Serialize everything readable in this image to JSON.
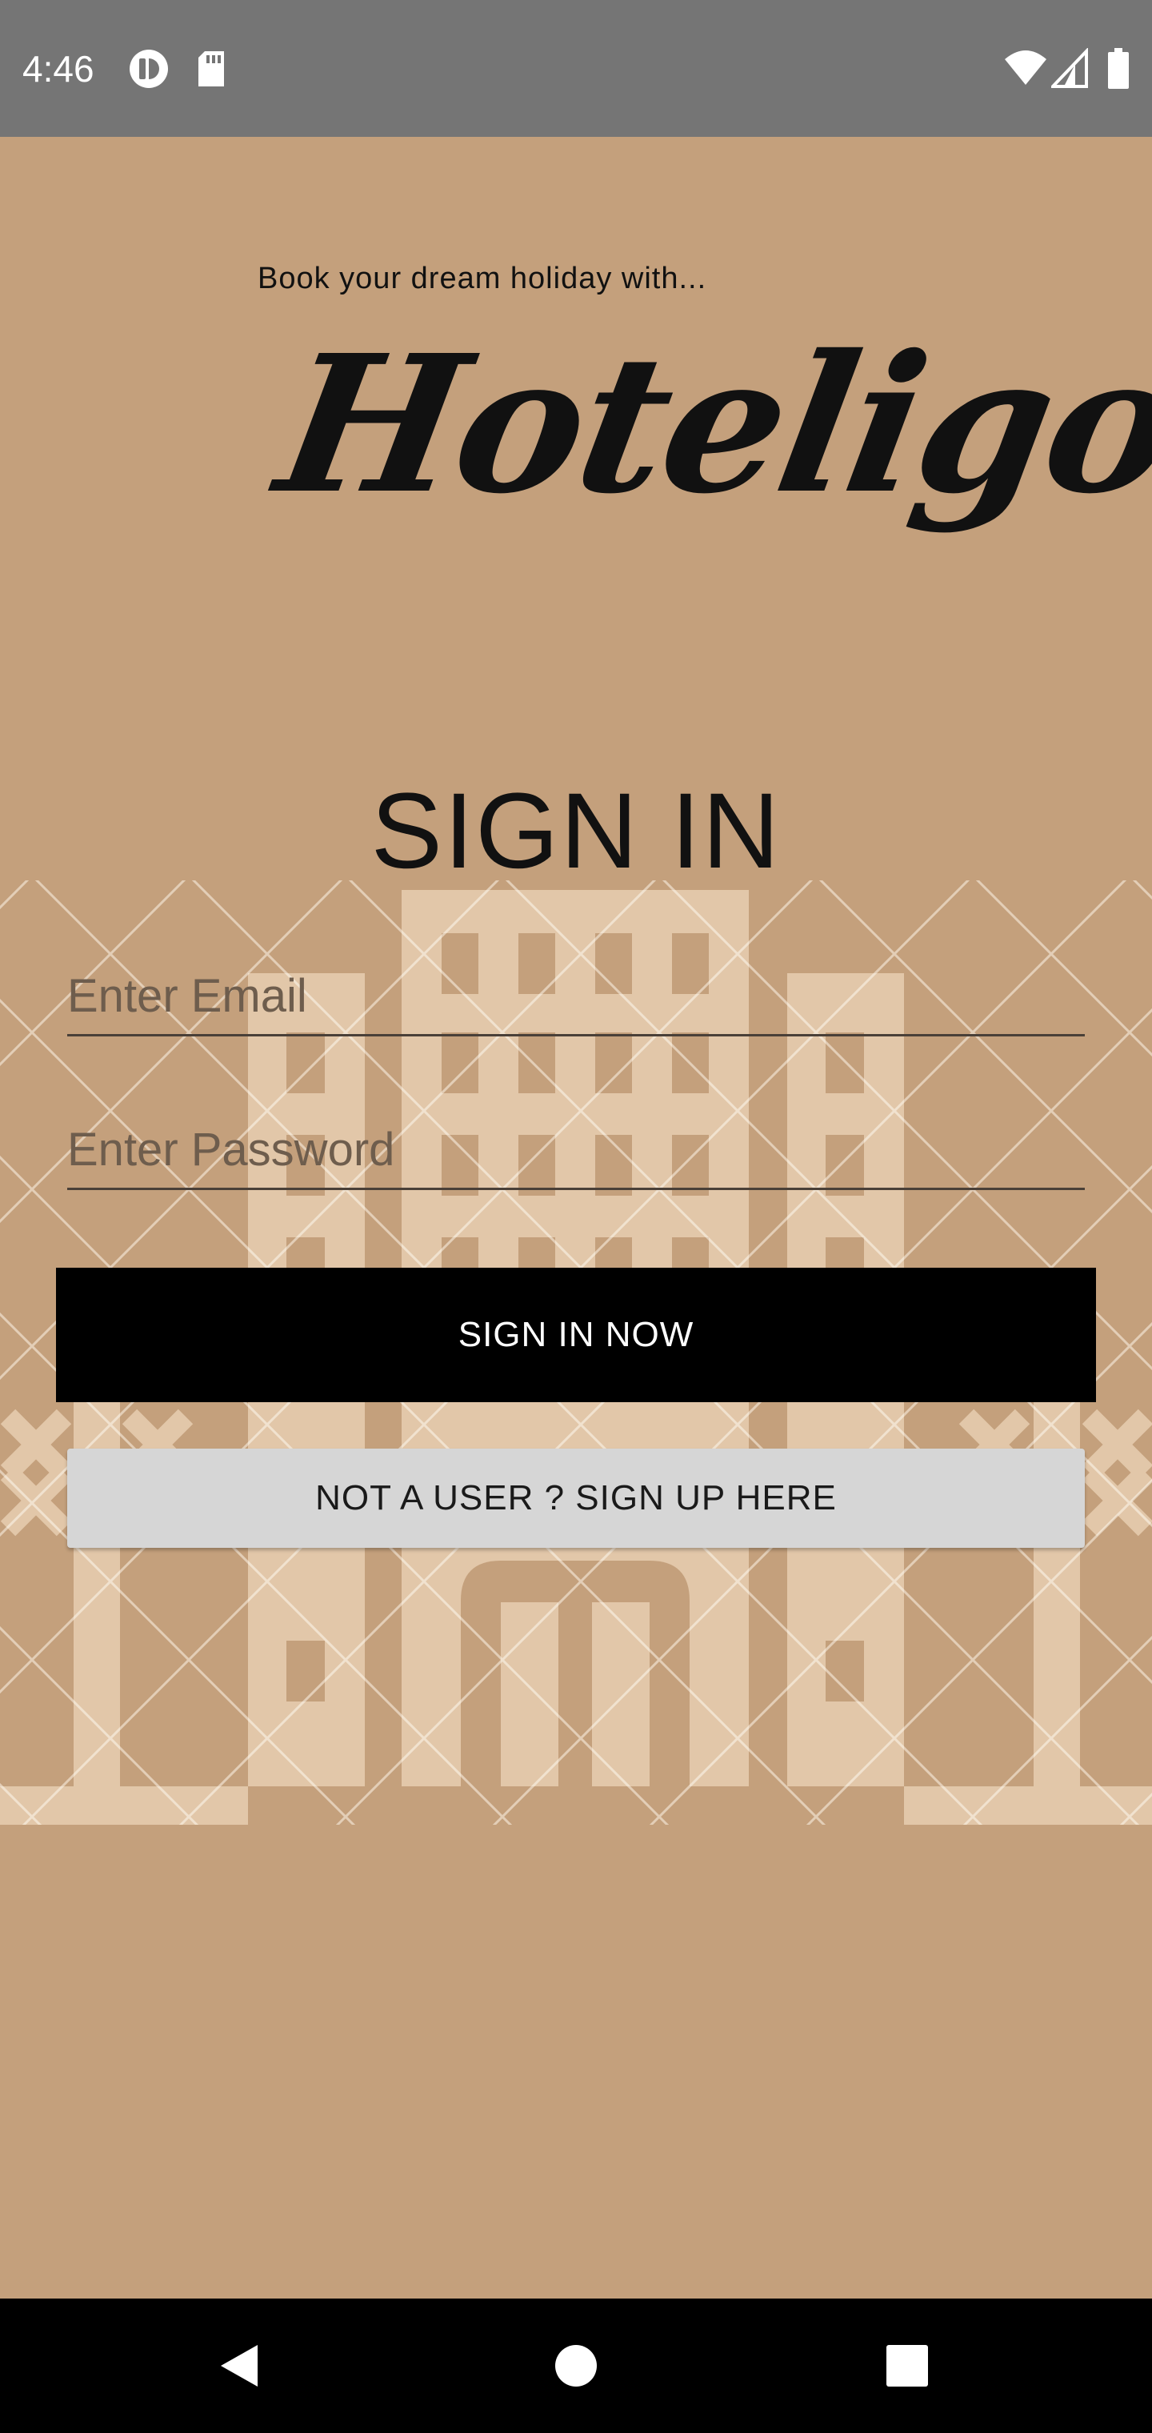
{
  "status_bar": {
    "time": "4:46",
    "left_icons": [
      "notification-app-icon",
      "sd-card-icon"
    ],
    "right_icons": [
      "wifi-icon",
      "cell-signal-icon",
      "battery-icon"
    ]
  },
  "header": {
    "tagline": "Book your dream holiday with...",
    "brand": "Hoteligo!"
  },
  "form": {
    "title": "SIGN IN",
    "email_placeholder": "Enter Email",
    "email_value": "",
    "password_placeholder": "Enter Password",
    "password_value": "",
    "submit_label": "SIGN IN NOW",
    "signup_label": "NOT A USER ? SIGN UP HERE"
  },
  "nav": {
    "buttons": [
      "back-icon",
      "home-icon",
      "recents-icon"
    ]
  },
  "colors": {
    "background": "#c4a07c",
    "building": "#e2c7a9",
    "status_bar": "#757575",
    "primary_button": "#000000",
    "secondary_button": "#d6d6d6"
  }
}
